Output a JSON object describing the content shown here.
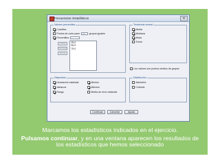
{
  "dialog": {
    "title": "Frecuencias: Estadísticos",
    "close_label": "✕",
    "percentiles": {
      "title": "Valores percentiles",
      "cuartiles": "Cuartiles",
      "puntos_corte": "Puntos de corte para:",
      "puntos_corte_value": "10",
      "grupos_iguales": "grupos iguales",
      "percentiles": "Percentiles:",
      "percentile_input": "",
      "add_button": "Añadir",
      "change_button": "Cambiar",
      "remove_button": "Borrar",
      "list": [
        "25,0",
        "50,0",
        "75,0"
      ]
    },
    "tendencia": {
      "title": "Tendencia central",
      "media": "Media",
      "mediana": "Mediana",
      "moda": "Moda",
      "suma": "Suma"
    },
    "midpoint_label": "Los valores son puntos medios de grupos",
    "dispersion": {
      "title": "Dispersión",
      "desviacion": "Desviación estándar",
      "varianza": "Varianza",
      "rango": "Rango",
      "minimo": "Mínimo",
      "maximo": "Máximo",
      "error_media": "Media de error estándar"
    },
    "distribucion": {
      "title": "Distribución",
      "asimetria": "Asimetría",
      "curtosis": "Curtosis"
    },
    "buttons": {
      "continuar": "Continuar",
      "cancelar": "Cancelar",
      "ayuda": "Ayuda"
    }
  },
  "caption": {
    "line1": "Marcamos los estadísticos indicados en el ejercicio.",
    "line2_bold": "Pulsamos continuar",
    "line2_rest": ", y en una ventana aparecen los resultados de los estadísticos que hemos seleccionado"
  },
  "colors": {
    "slide_background": "#93c96f",
    "group_title": "#1f4e8c"
  }
}
